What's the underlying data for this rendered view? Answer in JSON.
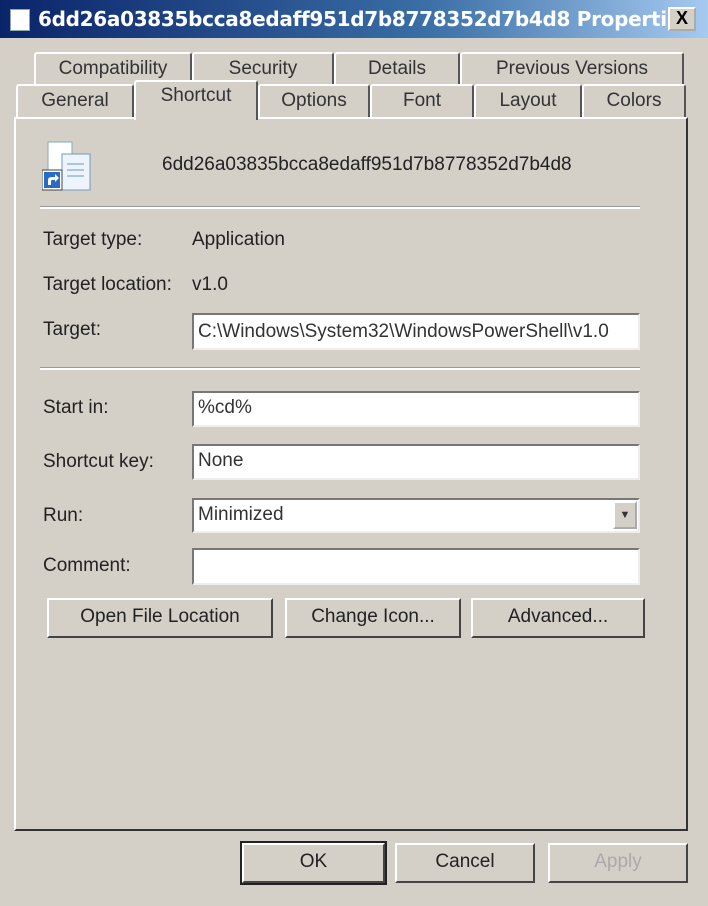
{
  "window": {
    "title": "6dd26a03835bcca8edaff951d7b8778352d7b4d8 Properti...",
    "close_label": "X"
  },
  "tabs_row1": [
    "Compatibility",
    "Security",
    "Details",
    "Previous Versions"
  ],
  "tabs_row2": [
    "General",
    "Shortcut",
    "Options",
    "Font",
    "Layout",
    "Colors"
  ],
  "active_tab": "Shortcut",
  "shortcut": {
    "file_name": "6dd26a03835bcca8edaff951d7b8778352d7b4d8",
    "target_type_label": "Target type:",
    "target_type": "Application",
    "target_location_label": "Target location:",
    "target_location": "v1.0",
    "target_label": "Target:",
    "target": "C:\\Windows\\System32\\WindowsPowerShell\\v1.0",
    "start_in_label": "Start in:",
    "start_in": "%cd%",
    "shortcut_key_label": "Shortcut key:",
    "shortcut_key": "None",
    "run_label": "Run:",
    "run": "Minimized",
    "comment_label": "Comment:",
    "comment": "",
    "open_file_location": "Open File Location",
    "change_icon": "Change Icon...",
    "advanced": "Advanced..."
  },
  "footer": {
    "ok": "OK",
    "cancel": "Cancel",
    "apply": "Apply"
  }
}
